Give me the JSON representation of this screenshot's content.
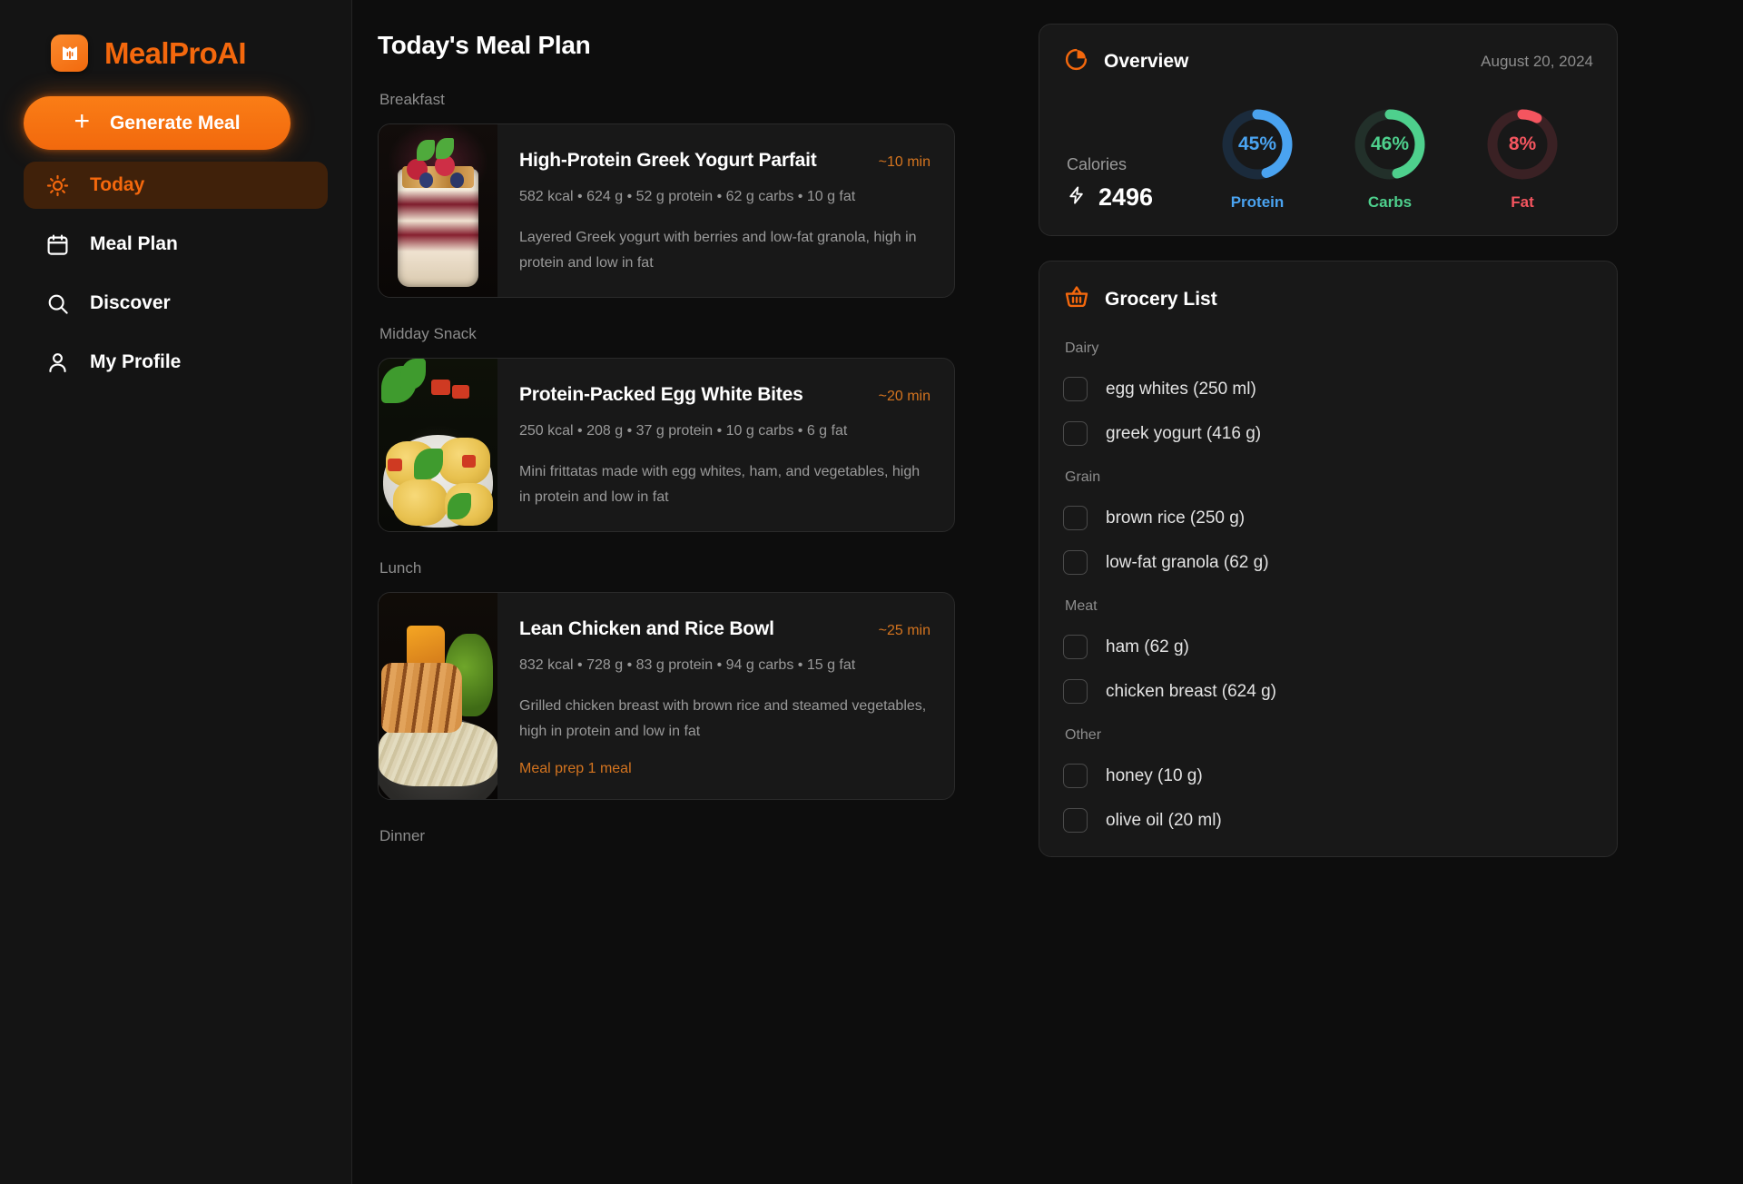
{
  "brand": {
    "name": "MealProAI",
    "logo_icon": "mealproai-logo-icon"
  },
  "sidebar": {
    "generate_button": {
      "label": "Generate Meal",
      "icon": "plus-icon"
    },
    "items": [
      {
        "label": "Today",
        "icon": "sun-icon",
        "active": true
      },
      {
        "label": "Meal Plan",
        "icon": "calendar-icon",
        "active": false
      },
      {
        "label": "Discover",
        "icon": "search-icon",
        "active": false
      },
      {
        "label": "My Profile",
        "icon": "user-icon",
        "active": false
      }
    ]
  },
  "main": {
    "page_title": "Today's Meal Plan",
    "sections": [
      {
        "label": "Breakfast",
        "meal": {
          "title": "High-Protein Greek Yogurt Parfait",
          "time": "~10 min",
          "macros": "582 kcal • 624 g • 52 g protein • 62 g carbs • 10 g fat",
          "description": "Layered Greek yogurt with berries and low-fat granola, high in protein and low in fat",
          "prep": ""
        }
      },
      {
        "label": "Midday Snack",
        "meal": {
          "title": "Protein-Packed Egg White Bites",
          "time": "~20 min",
          "macros": "250 kcal • 208 g • 37 g protein • 10 g carbs • 6 g fat",
          "description": "Mini frittatas made with egg whites, ham, and vegetables, high in protein and low in fat",
          "prep": ""
        }
      },
      {
        "label": "Lunch",
        "meal": {
          "title": "Lean Chicken and Rice Bowl",
          "time": "~25 min",
          "macros": "832 kcal • 728 g • 83 g protein • 94 g carbs • 15 g fat",
          "description": "Grilled chicken breast with brown rice and steamed vegetables, high in protein and low in fat",
          "prep": "Meal prep 1 meal"
        }
      },
      {
        "label": "Dinner",
        "meal": null
      }
    ]
  },
  "overview": {
    "title": "Overview",
    "icon": "pie-chart-icon",
    "date": "August 20, 2024",
    "calories_label": "Calories",
    "calories_value": "2496",
    "calories_icon": "lightning-bolt-icon",
    "rings": [
      {
        "label": "Protein",
        "percent_text": "45%",
        "percent": 45,
        "color": "#4aa3f0",
        "track": "#1b2b3c"
      },
      {
        "label": "Carbs",
        "percent_text": "46%",
        "percent": 46,
        "color": "#4ed08d",
        "track": "#22302a"
      },
      {
        "label": "Fat",
        "percent_text": "8%",
        "percent": 8,
        "color": "#f4555f",
        "track": "#3a2124"
      }
    ]
  },
  "grocery": {
    "title": "Grocery List",
    "icon": "basket-icon",
    "groups": [
      {
        "label": "Dairy",
        "items": [
          "egg whites (250 ml)",
          "greek yogurt (416 g)"
        ]
      },
      {
        "label": "Grain",
        "items": [
          "brown rice (250 g)",
          "low-fat granola (62 g)"
        ]
      },
      {
        "label": "Meat",
        "items": [
          "ham (62 g)",
          "chicken breast (624 g)"
        ]
      },
      {
        "label": "Other",
        "items": [
          "honey (10 g)",
          "olive oil (20 ml)"
        ]
      }
    ]
  }
}
